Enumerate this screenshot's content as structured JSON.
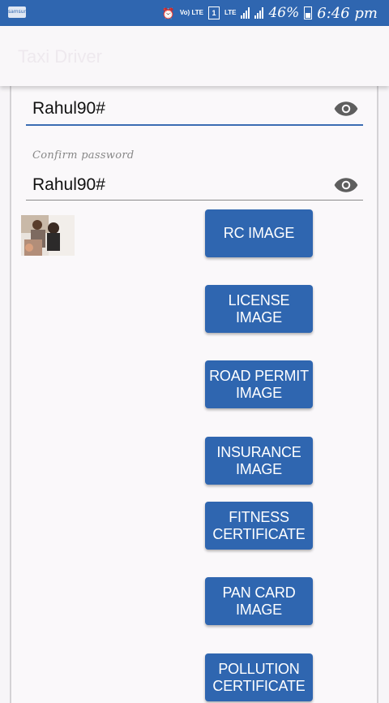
{
  "statusbar": {
    "notification_label": "samsung",
    "volte": "Vo) LTE",
    "sim": "1",
    "lte": "LTE",
    "battery_percent": "46%",
    "time": "6:46 pm",
    "icons": [
      "notification-icon",
      "alarm-icon",
      "volte-icon",
      "sim-icon",
      "lte-icon",
      "signal-icon",
      "signal2-icon",
      "battery-icon"
    ]
  },
  "appbar": {
    "title": "Taxi Driver"
  },
  "form": {
    "password": {
      "value": "Rahul90#"
    },
    "confirm_password": {
      "label": "Confirm password",
      "value": "Rahul90#"
    }
  },
  "buttons": [
    {
      "label": "RC IMAGE"
    },
    {
      "label": "LICENSE\nIMAGE"
    },
    {
      "label": "ROAD PERMIT\nIMAGE"
    },
    {
      "label": "INSURANCE\nIMAGE"
    },
    {
      "label": "FITNESS\nCERTIFICATE"
    },
    {
      "label": "PAN CARD\nIMAGE"
    },
    {
      "label": "POLLUTION\nCERTIFICATE"
    }
  ],
  "colors": {
    "primary": "#2f66b0",
    "field_focus": "#3b6db3"
  }
}
